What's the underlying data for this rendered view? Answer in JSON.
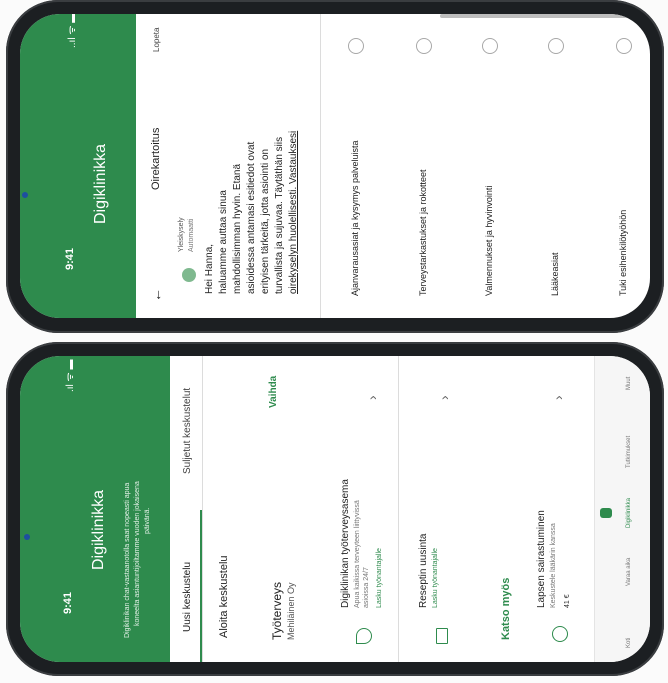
{
  "top": {
    "status_time": "9:41",
    "status_icons": "..ıl ᯤ ▬",
    "header_title": "Digiklinikka",
    "back_icon": "←",
    "chat_title": "Oirekartoitus",
    "end_label": "Lopeta",
    "sender_name": "Yleiskysely",
    "sender_sub": "Automaatti",
    "message_lines": [
      "Hei Hanna,",
      "haluamme auttaa sinua",
      "mahdollisimman hyvin. Etanä",
      "asioidessa antamasi esitiedot ovat",
      "erityisen tärkeitä, jotta asiointi on",
      "turvallista ja sujuvaa. Täytäthän siis",
      "oirekyselyn huolellisesti. Vastauksesi"
    ],
    "options": [
      "Ajanvarausasiat ja kysymys palveluista",
      "Terveystarkastukset ja rokotteet",
      "Valmennukset ja hyvinvointi",
      "Lääkeasiat",
      "Tuki esihenkilötyöhön"
    ]
  },
  "bottom": {
    "status_time": "9:41",
    "status_icons": ".ıl ᯤ ▬",
    "header_title": "Digiklinikka",
    "header_desc_lines": [
      "Digiklinikan chat-vastaanotolla saat nopeasti apua",
      "koneelta asiantuntijoiltamme vuoden jokaisena",
      "päivänä."
    ],
    "tab_new": "Uusi keskustelu",
    "tab_closed": "Suljetut keskustelut",
    "section_start": "Aloita keskustelu",
    "org_title": "Työterveys",
    "org_sub": "Mehiläinen Oy",
    "change_label": "Vaihda",
    "items": [
      {
        "title": "Digiklinikan työterveysasema",
        "sub1": "Apua kaikissa terveyteen liittyvissä",
        "sub2": "asioissa 24/7",
        "link": "Lasku työnantajalle",
        "icon": "stethoscope-icon"
      },
      {
        "title": "Reseptin uusinta",
        "sub1": "",
        "sub2": "",
        "link": "Lasku työnantajalle",
        "icon": "prescription-icon"
      }
    ],
    "see_also": "Katso myös",
    "extra_item": {
      "title": "Lapsen sairastuminen",
      "sub": "Keskustele lääkärin kanssa",
      "price": "41 €"
    },
    "nav": [
      "Koti",
      "Varaa aika",
      "Digiklinikka",
      "Tutkimukset",
      "Muut"
    ],
    "colors": {
      "green": "#2e8b4d",
      "green_text": "#2e8b4d"
    }
  }
}
